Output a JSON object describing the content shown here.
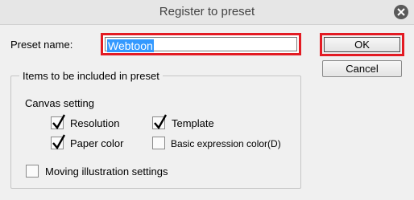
{
  "dialog": {
    "title": "Register to preset"
  },
  "preset_name": {
    "label": "Preset name:",
    "value": "Webtoon"
  },
  "buttons": {
    "ok": "OK",
    "cancel": "Cancel"
  },
  "group": {
    "legend": "Items to be included in preset",
    "canvas_setting_label": "Canvas setting",
    "options": [
      {
        "label": "Resolution",
        "checked": true
      },
      {
        "label": "Template",
        "checked": true
      },
      {
        "label": "Paper color",
        "checked": true
      },
      {
        "label": "Basic expression color(D)",
        "checked": false
      },
      {
        "label": "Moving illustration settings",
        "checked": false
      }
    ]
  },
  "colors": {
    "highlight_border": "#e31b23",
    "selection": "#3399ff"
  },
  "icons": {
    "close": "close-icon",
    "check": "checkmark-icon"
  }
}
